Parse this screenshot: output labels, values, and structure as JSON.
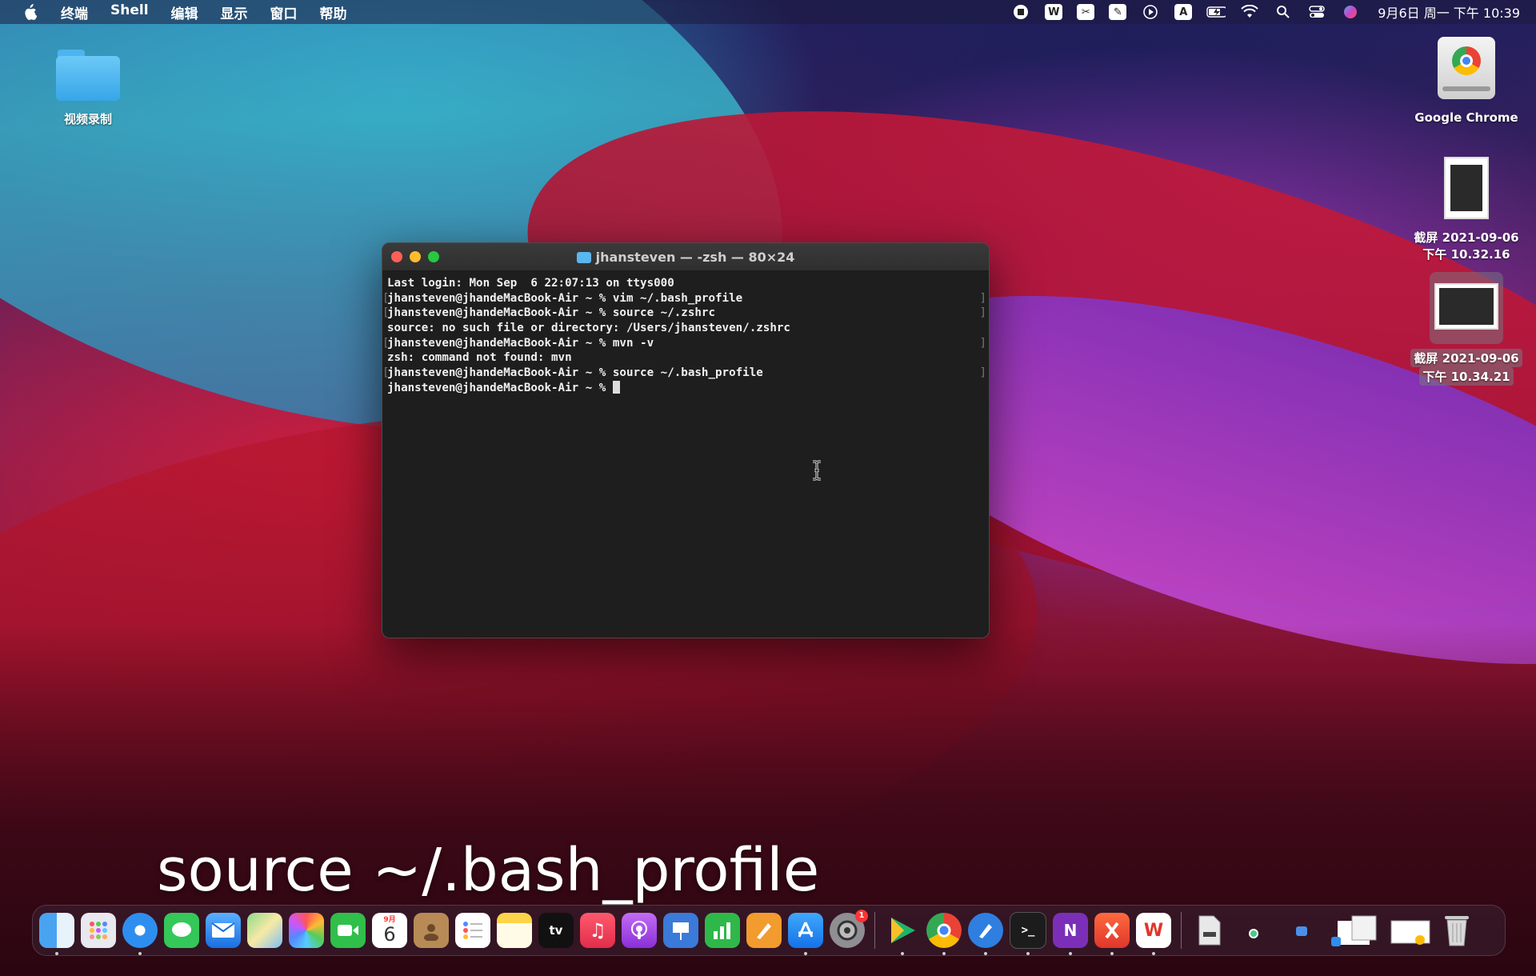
{
  "menubar": {
    "apple_icon": "apple-icon",
    "menus": [
      "终端",
      "Shell",
      "编辑",
      "显示",
      "窗口",
      "帮助"
    ],
    "status_icons": [
      "stop-record-icon",
      "wps-icon",
      "screenshot-tool-icon",
      "pen-icon",
      "play-icon",
      "input-method-icon",
      "battery-icon",
      "wifi-icon",
      "spotlight-icon",
      "control-center-icon",
      "siri-icon"
    ],
    "input_method_letter": "A",
    "clock": "9月6日 周一 下午 10:39"
  },
  "desktop": {
    "folder_label": "视频录制",
    "chrome_label": "Google Chrome",
    "screenshot1_label_line1": "截屏 2021-09-06",
    "screenshot1_label_line2": "下午 10.32.16",
    "screenshot2_label_line1": "截屏 2021-09-06",
    "screenshot2_label_line2": "下午 10.34.21"
  },
  "terminal": {
    "title": "jhansteven — -zsh — 80×24",
    "lines": [
      "Last login: Mon Sep  6 22:07:13 on ttys000",
      "jhansteven@jhandeMacBook-Air ~ % vim ~/.bash_profile",
      "jhansteven@jhandeMacBook-Air ~ % source ~/.zshrc",
      "source: no such file or directory: /Users/jhansteven/.zshrc",
      "jhansteven@jhandeMacBook-Air ~ % mvn -v",
      "zsh: command not found: mvn",
      "jhansteven@jhandeMacBook-Air ~ % source ~/.bash_profile",
      "jhansteven@jhandeMacBook-Air ~ % "
    ]
  },
  "caption": "source ~/.bash_profile",
  "dock": {
    "apps": [
      "finder",
      "launchpad",
      "safari",
      "messages",
      "mail",
      "maps",
      "photos",
      "facetime",
      "calendar",
      "contacts",
      "reminders",
      "notes",
      "tv",
      "music",
      "podcasts",
      "keynote",
      "numbers",
      "pages",
      "app-store",
      "system-preferences",
      "infuse",
      "chrome",
      "pen-app",
      "terminal",
      "onenote",
      "screenshot-app",
      "wps"
    ],
    "calendar_day": "6",
    "calendar_month": "9月",
    "tv_label": "tv",
    "prefs_badge": "1"
  },
  "colors": {
    "accent_red": "#fe5f57",
    "accent_yellow": "#febc2e",
    "accent_green": "#28c840"
  }
}
